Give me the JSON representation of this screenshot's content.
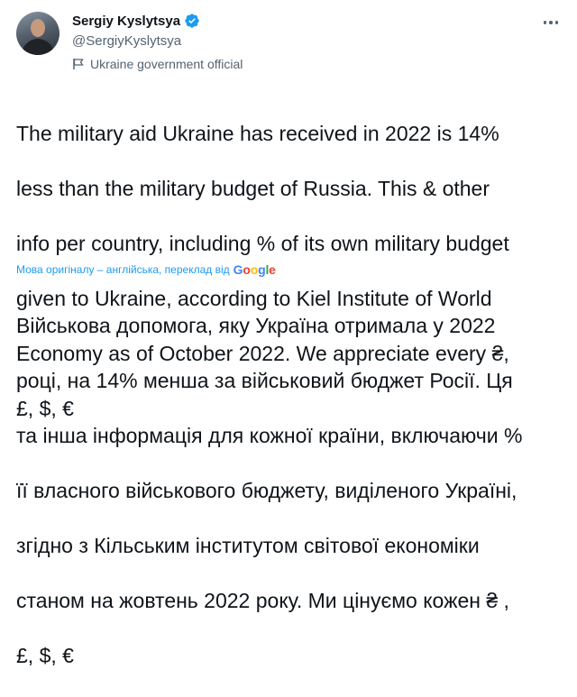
{
  "author": {
    "name": "Sergiy Kyslytsya",
    "handle": "@SergiyKyslytsya",
    "label": "Ukraine government official",
    "verified": true
  },
  "tweet": {
    "lines": [
      "The military aid Ukraine has received in 2022 is 14%",
      "less than the military budget of Russia. This & other",
      "info per country, including % of its own military budget",
      "given to Ukraine, according to Kiel Institute of World",
      "Economy as of October 2022. We appreciate every ₴,",
      "£, $, €"
    ]
  },
  "translation": {
    "note": "Мова оригіналу – англійська, переклад від",
    "provider": "Google",
    "lines": [
      "Військова допомога, яку Україна отримала у 2022",
      "році, на 14% менша за військовий бюджет Росії. Ця",
      "та інша інформація для кожної країни, включаючи %",
      "її власного військового бюджету, виділеного Україні,",
      "згідно з Кільським інститутом світової економіки",
      "станом на жовтень 2022 року. Ми цінуємо кожен ₴ ,",
      "£, $, €"
    ]
  },
  "colors": {
    "accent": "#1d9bf0",
    "secondary_text": "#536471",
    "primary_text": "#0f1419"
  },
  "icons": {
    "verified": "verified-badge-icon",
    "label": "government-flag-icon",
    "more": "more-options-icon"
  }
}
